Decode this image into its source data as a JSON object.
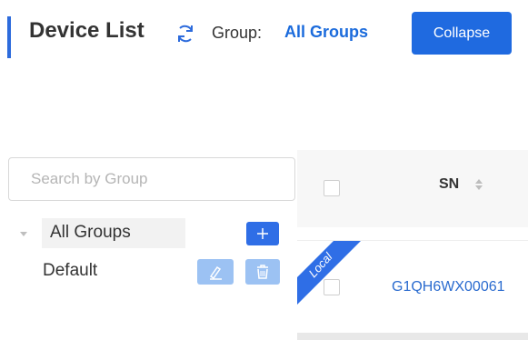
{
  "header": {
    "title": "Device List",
    "group_label": "Group:",
    "group_value": "All Groups",
    "collapse_label": "Collapse"
  },
  "group_panel": {
    "search_placeholder": "Search by Group",
    "tree": [
      {
        "label": "All Groups",
        "expanded": true
      },
      {
        "label": "Default"
      }
    ],
    "add_icon": "plus-icon",
    "edit_icon": "edit-icon",
    "delete_icon": "trash-icon"
  },
  "table": {
    "columns": [
      "SN"
    ],
    "rows": [
      {
        "sn": "G1QH6WX00061",
        "badge": "Local"
      }
    ]
  },
  "colors": {
    "accent": "#2d6bdc",
    "primary_button": "#1f6ae0",
    "link": "#2a6bcf",
    "disabled_button": "#9cc2f3"
  }
}
